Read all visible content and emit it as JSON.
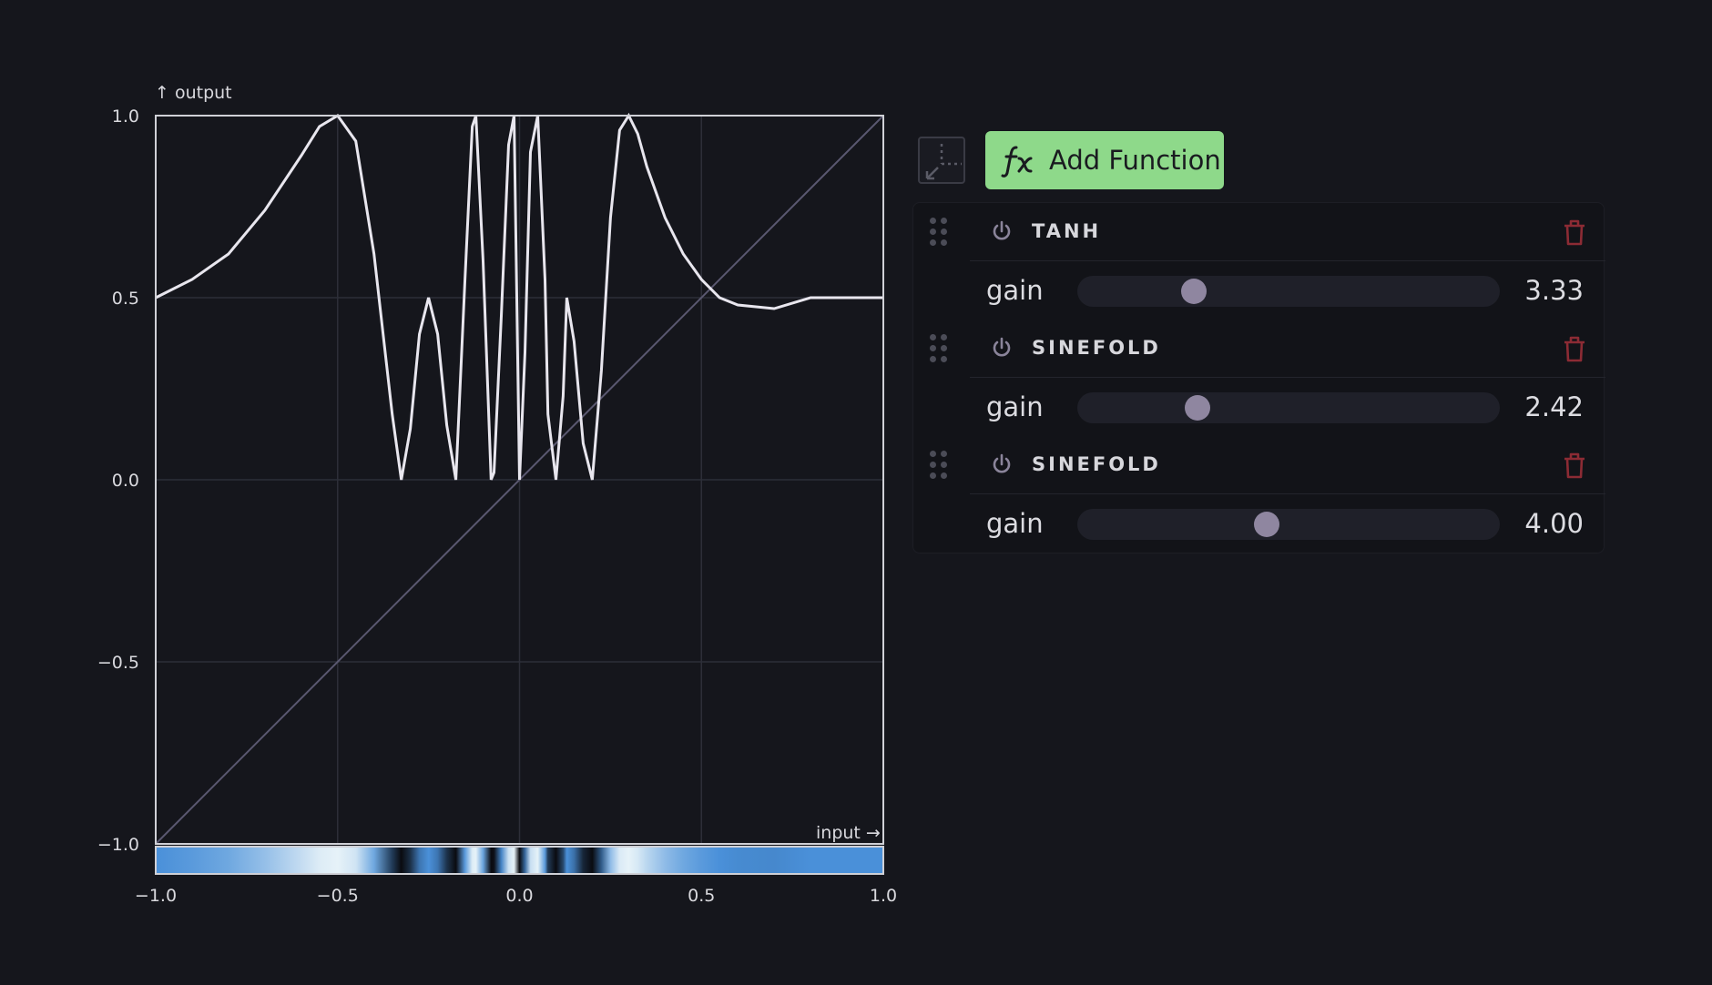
{
  "chart_data": {
    "type": "line",
    "xlabel": "input →",
    "ylabel": "↑ output",
    "xlim": [
      -1,
      1
    ],
    "ylim": [
      -1,
      1
    ],
    "x_ticks": [
      "−1.0",
      "−0.5",
      "0.0",
      "0.5",
      "1.0"
    ],
    "y_ticks": [
      "1.0",
      "0.5",
      "0.0",
      "−0.5",
      "−1.0"
    ],
    "grid": true,
    "series": [
      {
        "description_role": "transfer curve",
        "x": [
          -1.0,
          -0.9,
          -0.8,
          -0.7,
          -0.6,
          -0.55,
          -0.5,
          -0.45,
          -0.4,
          -0.35,
          -0.325,
          -0.3,
          -0.275,
          -0.25,
          -0.225,
          -0.2,
          -0.175,
          -0.15,
          -0.13,
          -0.12,
          -0.1,
          -0.078,
          -0.07,
          -0.05,
          -0.03,
          -0.015,
          0.0,
          0.015,
          0.03,
          0.05,
          0.07,
          0.078,
          0.1,
          0.12,
          0.13,
          0.15,
          0.175,
          0.2,
          0.225,
          0.25,
          0.275,
          0.3,
          0.325,
          0.35,
          0.4,
          0.45,
          0.5,
          0.55,
          0.6,
          0.7,
          0.8,
          0.9,
          1.0
        ],
        "y": [
          0.5,
          0.55,
          0.62,
          0.74,
          0.89,
          0.97,
          1.0,
          0.93,
          0.62,
          0.18,
          0.0,
          0.14,
          0.4,
          0.5,
          0.4,
          0.15,
          0.0,
          0.55,
          0.97,
          1.0,
          0.6,
          0.0,
          0.02,
          0.45,
          0.92,
          1.0,
          0.0,
          0.35,
          0.9,
          1.0,
          0.55,
          0.18,
          0.0,
          0.23,
          0.5,
          0.38,
          0.1,
          0.0,
          0.3,
          0.72,
          0.96,
          1.0,
          0.95,
          0.86,
          0.72,
          0.62,
          0.55,
          0.5,
          0.48,
          0.47,
          0.5,
          0.5,
          0.5
        ]
      },
      {
        "description_role": "identity reference",
        "x": [
          -1,
          1
        ],
        "y": [
          -1,
          1
        ]
      }
    ]
  },
  "toolbar": {
    "expand_icon": "expand-arrow-icon",
    "add_function_icon": "fx-icon",
    "add_function_label": "Add Function"
  },
  "functions": [
    {
      "name": "TANH",
      "param_label": "gain",
      "value": "3.33",
      "fraction": 0.275
    },
    {
      "name": "SINEFOLD",
      "param_label": "gain",
      "value": "2.42",
      "fraction": 0.285
    },
    {
      "name": "SINEFOLD",
      "param_label": "gain",
      "value": "4.00",
      "fraction": 0.448
    }
  ],
  "colors": {
    "background": "#15161c",
    "accent": "#8ed98a",
    "curve": "#e8e6ee",
    "slider_thumb": "#8f86a0",
    "trash": "#8c2b34",
    "gradient_low": "#0a0b10",
    "gradient_high": "#e6f2f8",
    "gradient_mid": "#4a90d9"
  }
}
